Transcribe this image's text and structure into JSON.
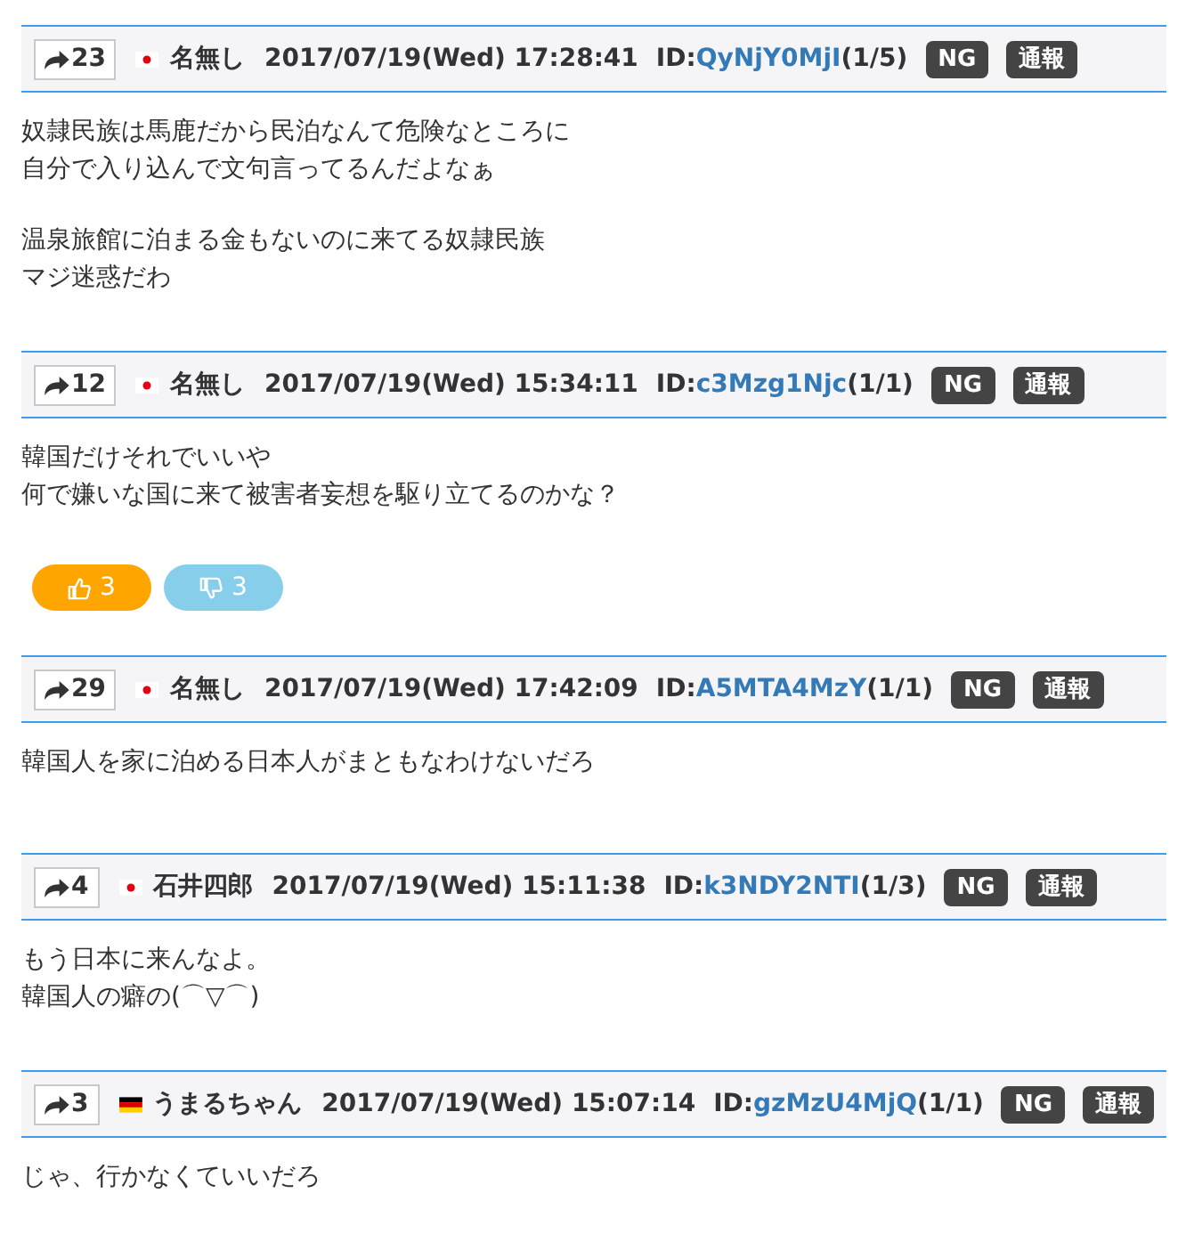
{
  "posts": [
    {
      "reply_count": "23",
      "flag": {
        "kind": "jp"
      },
      "name": "名無し",
      "date": "2017/07/19(Wed) 17:28:41",
      "id_label": "ID:",
      "id": "QyNjY0MjI",
      "post_count": "(1/5)",
      "buttons": [
        "NG",
        "通報"
      ],
      "paragraphs": [
        [
          "奴隷民族は馬鹿だから民泊なんて危険なところに",
          "自分で入り込んで文句言ってるんだよなぁ"
        ],
        [
          "温泉旅館に泊まる金もないのに来てる奴隷民族",
          "マジ迷惑だわ"
        ]
      ]
    },
    {
      "reply_count": "12",
      "flag": {
        "kind": "jp"
      },
      "name": "名無し",
      "date": "2017/07/19(Wed) 15:34:11",
      "id_label": "ID:",
      "id": "c3Mzg1Njc",
      "post_count": "(1/1)",
      "buttons": [
        "NG",
        "通報"
      ],
      "paragraphs": [
        [
          "韓国だけそれでいいや",
          "何で嫌いな国に来て被害者妄想を駆り立てるのかな？"
        ]
      ],
      "votes": {
        "up": "3",
        "down": "3"
      }
    },
    {
      "reply_count": "29",
      "flag": {
        "kind": "jp"
      },
      "name": "名無し",
      "date": "2017/07/19(Wed) 17:42:09",
      "id_label": "ID:",
      "id": "A5MTA4MzY",
      "post_count": "(1/1)",
      "buttons": [
        "NG",
        "通報"
      ],
      "paragraphs": [
        [
          "韓国人を家に泊める日本人がまともなわけないだろ"
        ]
      ]
    },
    {
      "reply_count": "4",
      "flag": {
        "kind": "jp"
      },
      "name": "石井四郎",
      "date": "2017/07/19(Wed) 15:11:38",
      "id_label": "ID:",
      "id": "k3NDY2NTI",
      "post_count": "(1/3)",
      "buttons": [
        "NG",
        "通報"
      ],
      "paragraphs": [
        [
          "もう日本に来んなよ。",
          "韓国人の癖の(⌒▽⌒)"
        ]
      ]
    },
    {
      "reply_count": "3",
      "flag": {
        "kind": "de"
      },
      "name": "うまるちゃん",
      "date": "2017/07/19(Wed) 15:07:14",
      "id_label": "ID:",
      "id": "gzMzU4MjQ",
      "post_count": "(1/1)",
      "buttons": [
        "NG",
        "通報"
      ],
      "paragraphs": [
        [
          "じゃ、行かなくていいだろ"
        ]
      ]
    }
  ]
}
